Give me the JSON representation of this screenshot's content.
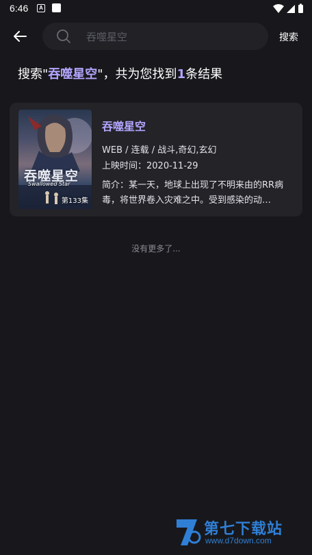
{
  "status_bar": {
    "time": "6:46",
    "notif_letter": "A"
  },
  "header": {
    "search_placeholder": "吞噬星空",
    "search_button": "搜索"
  },
  "summary": {
    "prefix": "搜索\"",
    "keyword": "吞噬星空",
    "middle": "\"，共为您找到",
    "count": "1",
    "suffix": "条结果"
  },
  "results": [
    {
      "title": "吞噬星空",
      "poster_title_cn": "吞噬星空",
      "poster_title_en": "Swallowed Star",
      "poster_episode": "第133集",
      "meta": "WEB / 连载 / 战斗,奇幻,玄幻",
      "release": "上映时间：2020-11-29",
      "synopsis": "简介：某一天，地球上出现了不明来由的RR病毒，将世界卷入灾难之中。受到感染的动…"
    }
  ],
  "footer": {
    "no_more": "没有更多了..."
  },
  "watermark": {
    "main": "第七下载站",
    "sub": "www.d7down.com"
  },
  "colors": {
    "accent": "#b3a6ff",
    "background": "#18181c",
    "card": "#232328"
  }
}
